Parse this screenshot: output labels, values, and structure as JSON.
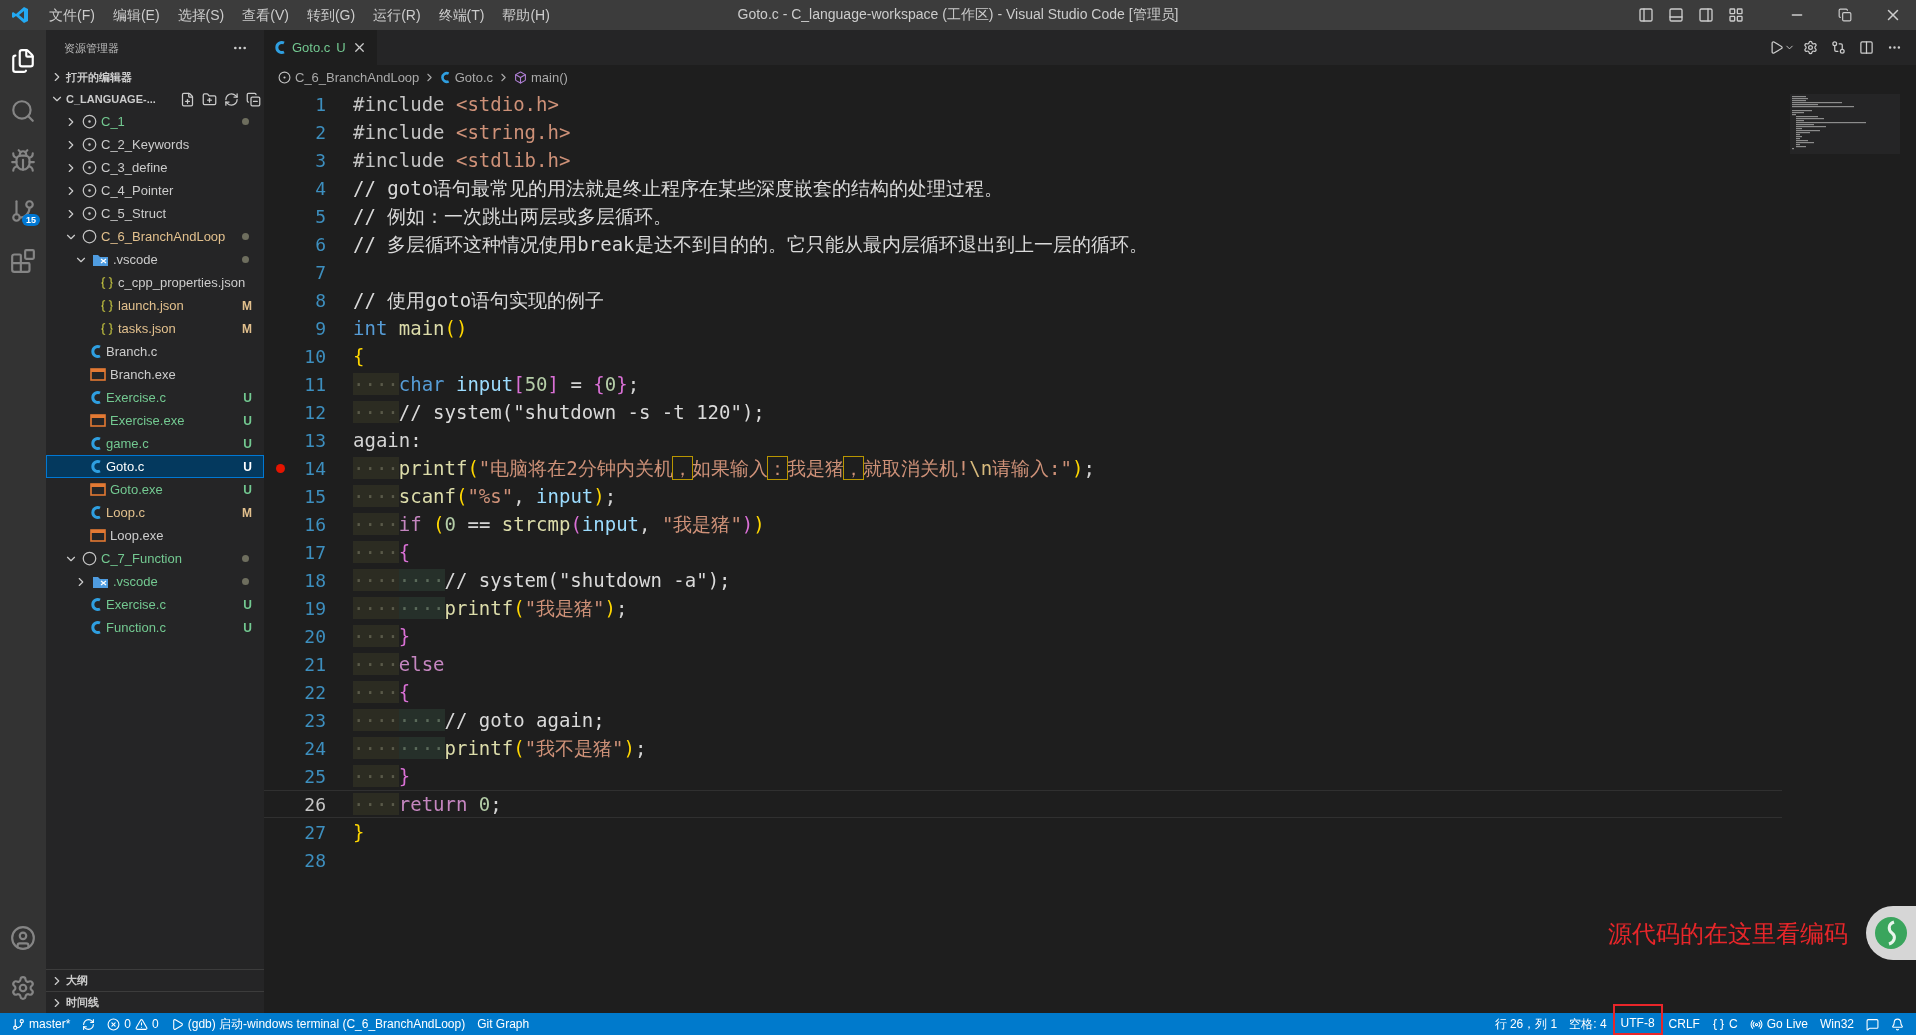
{
  "menu": [
    "文件(F)",
    "编辑(E)",
    "选择(S)",
    "查看(V)",
    "转到(G)",
    "运行(R)",
    "终端(T)",
    "帮助(H)"
  ],
  "window": {
    "title": "Goto.c - C_language-workspace (工作区) - Visual Studio Code [管理员]"
  },
  "activity_bar": {
    "source_control_badge": "15"
  },
  "sidebar": {
    "title": "资源管理器",
    "open_editors": {
      "label": "打开的编辑器",
      "expanded": false
    },
    "workspace": {
      "label": "C_LANGUAGE-...",
      "expanded": true,
      "items": [
        {
          "name": "C_1",
          "kind": "project",
          "expanded": false,
          "color": "#73c991",
          "changed": true,
          "selected": false
        },
        {
          "name": "C_2_Keywords",
          "kind": "project",
          "expanded": false,
          "color": "#cccccc",
          "changed": false,
          "selected": false
        },
        {
          "name": "C_3_define",
          "kind": "project",
          "expanded": false,
          "color": "#cccccc",
          "changed": false,
          "selected": false
        },
        {
          "name": "C_4_Pointer",
          "kind": "project",
          "expanded": false,
          "color": "#cccccc",
          "changed": false,
          "selected": false
        },
        {
          "name": "C_5_Struct",
          "kind": "project",
          "expanded": false,
          "color": "#cccccc",
          "changed": false,
          "selected": false
        },
        {
          "name": "C_6_BranchAndLoop",
          "kind": "project",
          "expanded": true,
          "color": "#e2c08d",
          "changed": true,
          "selected": false,
          "children": [
            {
              "name": ".vscode",
              "kind": "folder",
              "expanded": true,
              "color": "#cccccc",
              "changed": true,
              "selected": false,
              "children": [
                {
                  "name": "c_cpp_properties.json",
                  "kind": "json",
                  "color": "#cccccc",
                  "selected": false
                },
                {
                  "name": "launch.json",
                  "kind": "json",
                  "color": "#e2c08d",
                  "badge": "M",
                  "selected": false
                },
                {
                  "name": "tasks.json",
                  "kind": "json",
                  "color": "#e2c08d",
                  "badge": "M",
                  "selected": false
                }
              ]
            },
            {
              "name": "Branch.c",
              "kind": "c",
              "color": "#cccccc",
              "selected": false
            },
            {
              "name": "Branch.exe",
              "kind": "exe",
              "color": "#cccccc",
              "selected": false
            },
            {
              "name": "Exercise.c",
              "kind": "c",
              "color": "#73c991",
              "badge": "U",
              "selected": false
            },
            {
              "name": "Exercise.exe",
              "kind": "exe",
              "color": "#73c991",
              "badge": "U",
              "selected": false
            },
            {
              "name": "game.c",
              "kind": "c",
              "color": "#73c991",
              "badge": "U",
              "selected": false
            },
            {
              "name": "Goto.c",
              "kind": "c",
              "color": "#ffffff",
              "badge": "U",
              "selected": true
            },
            {
              "name": "Goto.exe",
              "kind": "exe",
              "color": "#73c991",
              "badge": "U",
              "selected": false
            },
            {
              "name": "Loop.c",
              "kind": "c",
              "color": "#e2c08d",
              "badge": "M",
              "selected": false
            },
            {
              "name": "Loop.exe",
              "kind": "exe",
              "color": "#cccccc",
              "selected": false
            }
          ]
        },
        {
          "name": "C_7_Function",
          "kind": "project",
          "expanded": true,
          "color": "#73c991",
          "changed": true,
          "selected": false,
          "children": [
            {
              "name": ".vscode",
              "kind": "folder",
              "expanded": false,
              "color": "#73c991",
              "changed": true,
              "selected": false
            },
            {
              "name": "Exercise.c",
              "kind": "c",
              "color": "#73c991",
              "badge": "U",
              "selected": false
            },
            {
              "name": "Function.c",
              "kind": "c",
              "color": "#73c991",
              "badge": "U",
              "selected": false
            }
          ]
        }
      ]
    },
    "bottom_sections": [
      {
        "label": "大纲",
        "expanded": false
      },
      {
        "label": "时间线",
        "expanded": false
      }
    ]
  },
  "tabs": [
    {
      "label": "Goto.c",
      "badge": "U",
      "selected": true
    }
  ],
  "breadcrumbs": [
    "C_6_BranchAndLoop",
    "Goto.c",
    "main()"
  ],
  "code_lines": [
    {
      "number": "1",
      "breakpoint": false,
      "current": false,
      "tokens": [
        {
          "kind": "preproc",
          "text": "#include"
        },
        {
          "kind": "string",
          "text": " <stdio.h>"
        }
      ]
    },
    {
      "number": "2",
      "breakpoint": false,
      "current": false,
      "tokens": [
        {
          "kind": "preproc",
          "text": "#include"
        },
        {
          "kind": "string",
          "text": " <string.h>"
        }
      ]
    },
    {
      "number": "3",
      "breakpoint": false,
      "current": false,
      "tokens": [
        {
          "kind": "preproc",
          "text": "#include"
        },
        {
          "kind": "string",
          "text": " <stdlib.h>"
        }
      ]
    },
    {
      "number": "4",
      "breakpoint": false,
      "current": false,
      "tokens": [
        {
          "kind": "comment",
          "text": "// goto语句最常见的用法就是终止程序在某些深度嵌套的结构的处理过程。"
        }
      ]
    },
    {
      "number": "5",
      "breakpoint": false,
      "current": false,
      "tokens": [
        {
          "kind": "comment",
          "text": "// 例如：一次跳出两层或多层循环。"
        }
      ]
    },
    {
      "number": "6",
      "breakpoint": false,
      "current": false,
      "tokens": [
        {
          "kind": "comment",
          "text": "// 多层循环这种情况使用break是达不到目的的。它只能从最内层循环退出到上一层的循环。"
        }
      ]
    },
    {
      "number": "7",
      "breakpoint": false,
      "current": false
    },
    {
      "number": "8",
      "breakpoint": false,
      "current": false,
      "tokens": [
        {
          "kind": "comment",
          "text": "// 使用goto语句实现的例子"
        }
      ]
    },
    {
      "number": "9",
      "breakpoint": false,
      "current": false,
      "tokens": [
        {
          "kind": "keyword",
          "text": "int"
        },
        {
          "kind": "function",
          "text": " main"
        },
        {
          "kind": "bracket1",
          "text": "()"
        }
      ]
    },
    {
      "number": "10",
      "breakpoint": false,
      "current": false,
      "tokens": [
        {
          "kind": "bracket1",
          "text": "{"
        }
      ]
    },
    {
      "number": "11",
      "breakpoint": false,
      "current": false,
      "tokens": [
        {
          "kind": "indent1",
          "text": "····"
        },
        {
          "kind": "keyword",
          "text": "char"
        },
        {
          "kind": "variable",
          "text": " input"
        },
        {
          "kind": "bracket2",
          "text": "["
        },
        {
          "kind": "number",
          "text": "50"
        },
        {
          "kind": "bracket2",
          "text": "]"
        },
        {
          "kind": "plain",
          "text": " = "
        },
        {
          "kind": "bracket2",
          "text": "{"
        },
        {
          "kind": "number",
          "text": "0"
        },
        {
          "kind": "bracket2",
          "text": "}"
        },
        {
          "kind": "plain",
          "text": ";"
        }
      ]
    },
    {
      "number": "12",
      "breakpoint": false,
      "current": false,
      "tokens": [
        {
          "kind": "indent1",
          "text": "····"
        },
        {
          "kind": "comment",
          "text": "// system(\"shutdown -s -t 120\");"
        }
      ]
    },
    {
      "number": "13",
      "breakpoint": false,
      "current": false,
      "tokens": [
        {
          "kind": "plain",
          "text": "again:"
        }
      ]
    },
    {
      "number": "14",
      "breakpoint": true,
      "current": false,
      "tokens": [
        {
          "kind": "indent1",
          "text": "····"
        },
        {
          "kind": "function",
          "text": "printf"
        },
        {
          "kind": "bracket1",
          "text": "("
        },
        {
          "kind": "string",
          "text": "\"电脑将在2分钟内关机"
        },
        {
          "kind": "unusual",
          "text": "，"
        },
        {
          "kind": "string",
          "text": "如果输入"
        },
        {
          "kind": "unusual",
          "text": "："
        },
        {
          "kind": "string",
          "text": "我是猪"
        },
        {
          "kind": "unusual",
          "text": "，"
        },
        {
          "kind": "string",
          "text": "就取消关机!"
        },
        {
          "kind": "escape",
          "text": "\\n"
        },
        {
          "kind": "string",
          "text": "请输入:\""
        },
        {
          "kind": "bracket1",
          "text": ")"
        },
        {
          "kind": "plain",
          "text": ";"
        }
      ]
    },
    {
      "number": "15",
      "breakpoint": false,
      "current": false,
      "tokens": [
        {
          "kind": "indent1",
          "text": "····"
        },
        {
          "kind": "function",
          "text": "scanf"
        },
        {
          "kind": "bracket1",
          "text": "("
        },
        {
          "kind": "string",
          "text": "\"%s\""
        },
        {
          "kind": "plain",
          "text": ","
        },
        {
          "kind": "variable",
          "text": " input"
        },
        {
          "kind": "bracket1",
          "text": ")"
        },
        {
          "kind": "plain",
          "text": ";"
        }
      ]
    },
    {
      "number": "16",
      "breakpoint": false,
      "current": false,
      "tokens": [
        {
          "kind": "indent1",
          "text": "····"
        },
        {
          "kind": "control",
          "text": "if"
        },
        {
          "kind": "bracket1",
          "text": " ("
        },
        {
          "kind": "number",
          "text": "0"
        },
        {
          "kind": "plain",
          "text": " == "
        },
        {
          "kind": "function",
          "text": "strcmp"
        },
        {
          "kind": "bracket2",
          "text": "("
        },
        {
          "kind": "variable",
          "text": "input"
        },
        {
          "kind": "plain",
          "text": ","
        },
        {
          "kind": "string",
          "text": " \"我是猪\""
        },
        {
          "kind": "bracket2",
          "text": ")"
        },
        {
          "kind": "bracket1",
          "text": ")"
        }
      ]
    },
    {
      "number": "17",
      "breakpoint": false,
      "current": false,
      "tokens": [
        {
          "kind": "indent1",
          "text": "····"
        },
        {
          "kind": "bracket2",
          "text": "{"
        }
      ]
    },
    {
      "number": "18",
      "breakpoint": false,
      "current": false,
      "tokens": [
        {
          "kind": "indent1",
          "text": "····"
        },
        {
          "kind": "indent2",
          "text": "····"
        },
        {
          "kind": "comment",
          "text": "// system(\"shutdown -a\");"
        }
      ]
    },
    {
      "number": "19",
      "breakpoint": false,
      "current": false,
      "tokens": [
        {
          "kind": "indent1",
          "text": "····"
        },
        {
          "kind": "indent2",
          "text": "····"
        },
        {
          "kind": "function",
          "text": "printf"
        },
        {
          "kind": "bracket1",
          "text": "("
        },
        {
          "kind": "string",
          "text": "\"我是猪\""
        },
        {
          "kind": "bracket1",
          "text": ")"
        },
        {
          "kind": "plain",
          "text": ";"
        }
      ]
    },
    {
      "number": "20",
      "breakpoint": false,
      "current": false,
      "tokens": [
        {
          "kind": "indent1",
          "text": "····"
        },
        {
          "kind": "bracket2",
          "text": "}"
        }
      ]
    },
    {
      "number": "21",
      "breakpoint": false,
      "current": false,
      "tokens": [
        {
          "kind": "indent1",
          "text": "····"
        },
        {
          "kind": "control",
          "text": "else"
        }
      ]
    },
    {
      "number": "22",
      "breakpoint": false,
      "current": false,
      "tokens": [
        {
          "kind": "indent1",
          "text": "····"
        },
        {
          "kind": "bracket2",
          "text": "{"
        }
      ]
    },
    {
      "number": "23",
      "breakpoint": false,
      "current": false,
      "tokens": [
        {
          "kind": "indent1",
          "text": "····"
        },
        {
          "kind": "indent2",
          "text": "····"
        },
        {
          "kind": "comment",
          "text": "// goto again;"
        }
      ]
    },
    {
      "number": "24",
      "breakpoint": false,
      "current": false,
      "tokens": [
        {
          "kind": "indent1",
          "text": "····"
        },
        {
          "kind": "indent2",
          "text": "····"
        },
        {
          "kind": "function",
          "text": "printf"
        },
        {
          "kind": "bracket1",
          "text": "("
        },
        {
          "kind": "string",
          "text": "\"我不是猪\""
        },
        {
          "kind": "bracket1",
          "text": ")"
        },
        {
          "kind": "plain",
          "text": ";"
        }
      ]
    },
    {
      "number": "25",
      "breakpoint": false,
      "current": false,
      "tokens": [
        {
          "kind": "indent1",
          "text": "····"
        },
        {
          "kind": "bracket2",
          "text": "}"
        }
      ]
    },
    {
      "number": "26",
      "breakpoint": false,
      "current": true,
      "tokens": [
        {
          "kind": "indent1",
          "text": "····"
        },
        {
          "kind": "control",
          "text": "return"
        },
        {
          "kind": "number",
          "text": " 0"
        },
        {
          "kind": "plain",
          "text": ";"
        }
      ]
    },
    {
      "number": "27",
      "breakpoint": false,
      "current": false,
      "tokens": [
        {
          "kind": "bracket1",
          "text": "}"
        }
      ]
    },
    {
      "number": "28",
      "breakpoint": false,
      "current": false
    }
  ],
  "annotation": {
    "text": "源代码的在这里看编码"
  },
  "status_left": [
    {
      "kind": "branch",
      "text": "master*"
    },
    {
      "kind": "sync"
    },
    {
      "kind": "problems",
      "errors": "0",
      "warnings": "0"
    },
    {
      "kind": "debug",
      "text": "(gdb) 启动-windows terminal (C_6_BranchAndLoop)"
    },
    {
      "kind": "text",
      "text": "Git Graph"
    }
  ],
  "status_right": [
    {
      "kind": "text",
      "text": "行 26，列 1",
      "highlighted": false
    },
    {
      "kind": "text",
      "text": "空格: 4",
      "highlighted": false
    },
    {
      "kind": "text",
      "text": "UTF-8",
      "highlighted": true
    },
    {
      "kind": "text",
      "text": "CRLF",
      "highlighted": false
    },
    {
      "kind": "language",
      "text": "C",
      "highlighted": false
    },
    {
      "kind": "live",
      "text": "Go Live",
      "highlighted": false
    },
    {
      "kind": "text",
      "text": "Win32",
      "highlighted": false
    },
    {
      "kind": "feedback",
      "highlighted": false
    },
    {
      "kind": "bell",
      "highlighted": false
    }
  ]
}
